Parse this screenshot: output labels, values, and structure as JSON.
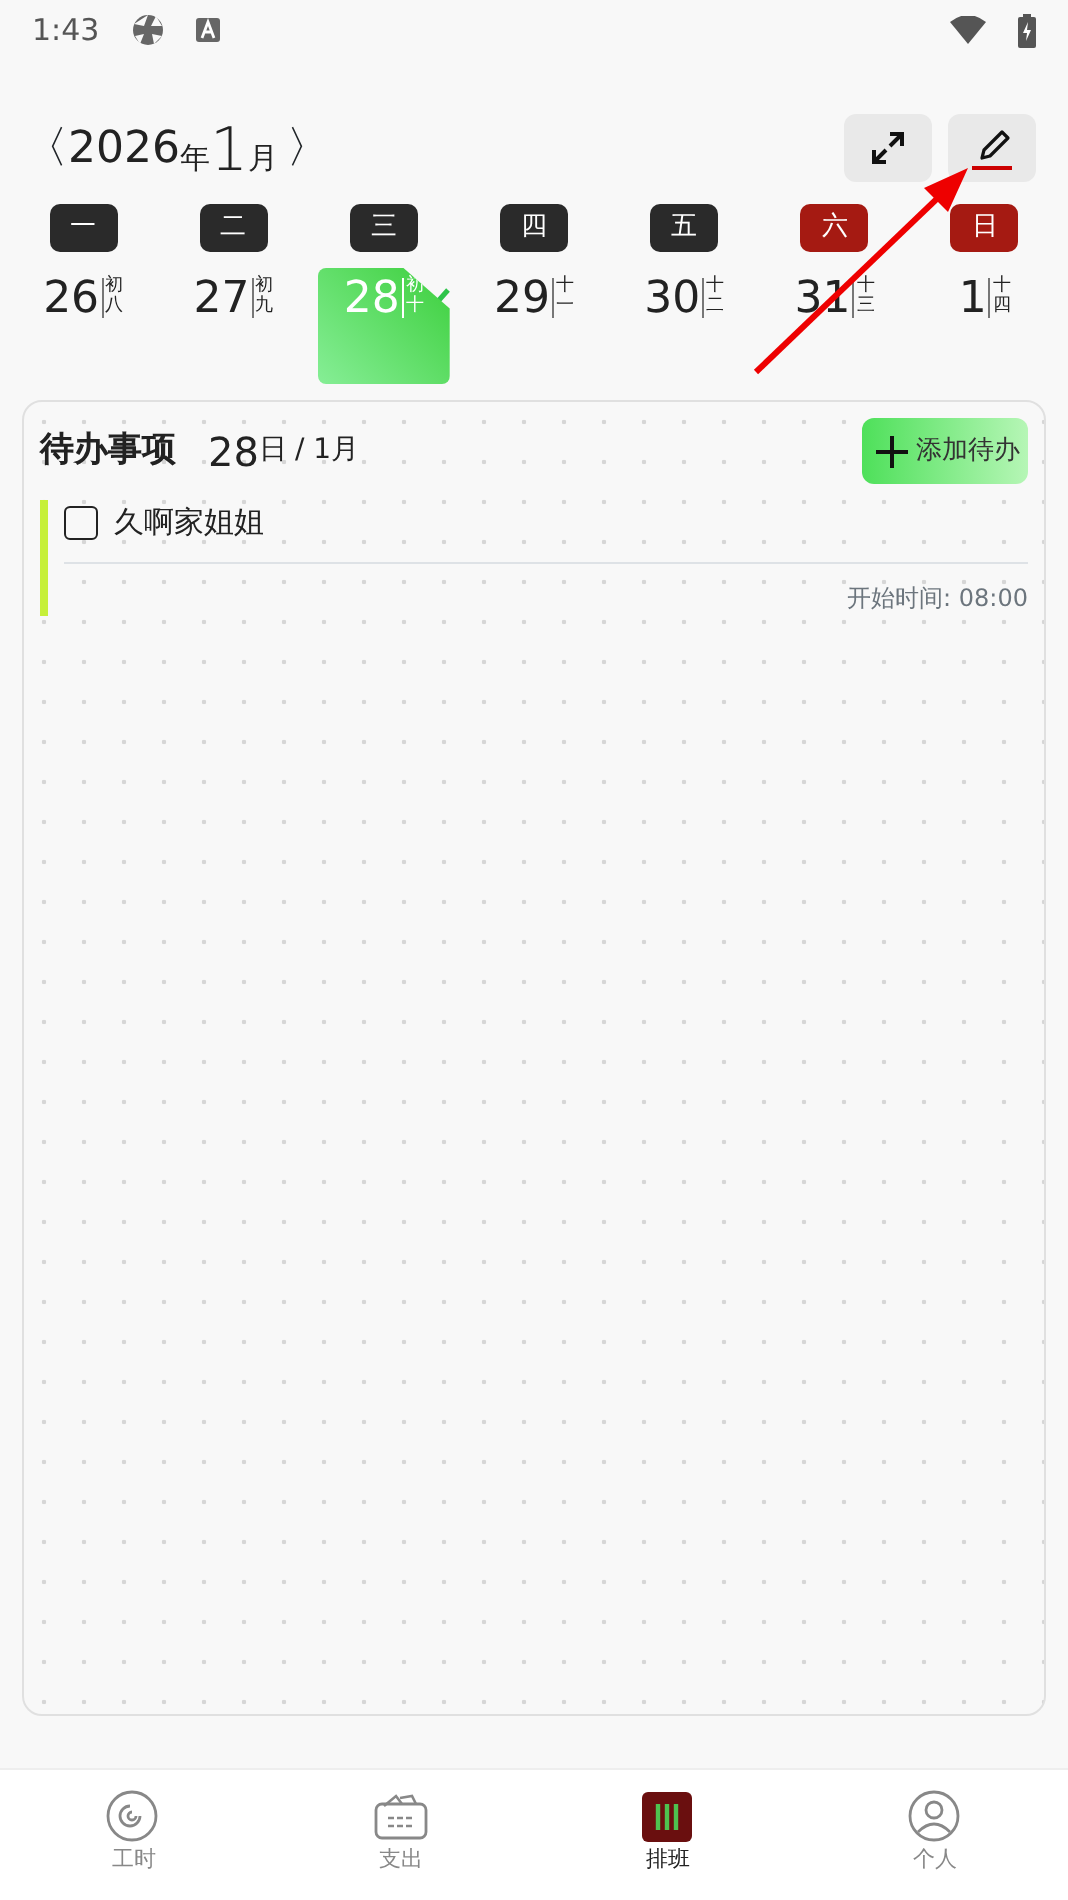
{
  "status_bar": {
    "time": "1:43"
  },
  "header": {
    "prev": "〈",
    "year": "2026",
    "year_unit": "年",
    "month": "1",
    "month_unit": "月",
    "next": "〉"
  },
  "weekdays": [
    {
      "label": "一",
      "weekend": false
    },
    {
      "label": "二",
      "weekend": false
    },
    {
      "label": "三",
      "weekend": false
    },
    {
      "label": "四",
      "weekend": false
    },
    {
      "label": "五",
      "weekend": false
    },
    {
      "label": "六",
      "weekend": true
    },
    {
      "label": "日",
      "weekend": true
    }
  ],
  "days": [
    {
      "day": "26",
      "lunar": "初八",
      "selected": false,
      "done": false
    },
    {
      "day": "27",
      "lunar": "初九",
      "selected": false,
      "done": false
    },
    {
      "day": "28",
      "lunar": "初十",
      "selected": true,
      "done": true
    },
    {
      "day": "29",
      "lunar": "十一",
      "selected": false,
      "done": false
    },
    {
      "day": "30",
      "lunar": "十二",
      "selected": false,
      "done": false
    },
    {
      "day": "31",
      "lunar": "十三",
      "selected": false,
      "done": false
    },
    {
      "day": "1",
      "lunar": "十四",
      "selected": false,
      "done": false
    }
  ],
  "todo": {
    "title": "待办事项",
    "date_day": "28",
    "date_day_unit": "日",
    "date_month": "/ 1月",
    "add_button": "添加待办",
    "items": [
      {
        "text": "久啊家姐姐",
        "checked": false,
        "start_time": "开始时间: 08:00",
        "color": "#c6f03a"
      }
    ]
  },
  "bottom_nav": [
    {
      "label": "工时",
      "kind": "clock",
      "selected": false
    },
    {
      "label": "支出",
      "kind": "wallet",
      "selected": false
    },
    {
      "label": "排班",
      "kind": "schedule",
      "selected": true
    },
    {
      "label": "个人",
      "kind": "person",
      "selected": false
    }
  ]
}
